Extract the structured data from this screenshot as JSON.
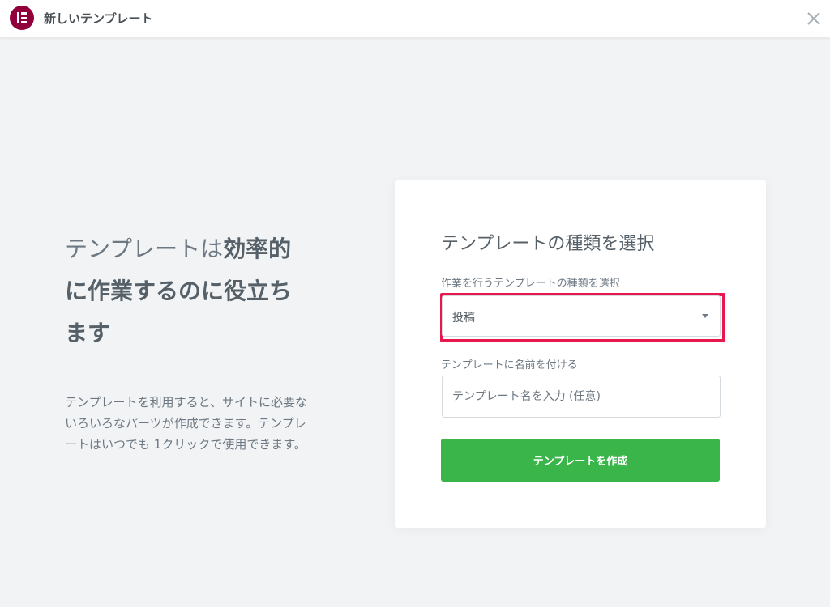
{
  "header": {
    "title": "新しいテンプレート",
    "logo_icon": "elementor-logo-icon",
    "close_icon": "close-icon"
  },
  "intro": {
    "title_normal": "テンプレートは",
    "title_bold": "効率的に作業するのに役立ちます",
    "description": "テンプレートを利用すると、サイトに必要ないろいろなパーツが作成できます。テンプレートはいつでも 1クリックで使用できます。"
  },
  "form": {
    "title": "テンプレートの種類を選択",
    "type_label": "作業を行うテンプレートの種類を選択",
    "type_value": "投稿",
    "name_label": "テンプレートに名前を付ける",
    "name_placeholder": "テンプレート名を入力 (任意)",
    "submit_label": "テンプレートを作成"
  },
  "colors": {
    "brand": "#92003b",
    "highlight": "#e8174e",
    "submit": "#39b54a",
    "background": "#f1f3f5"
  }
}
